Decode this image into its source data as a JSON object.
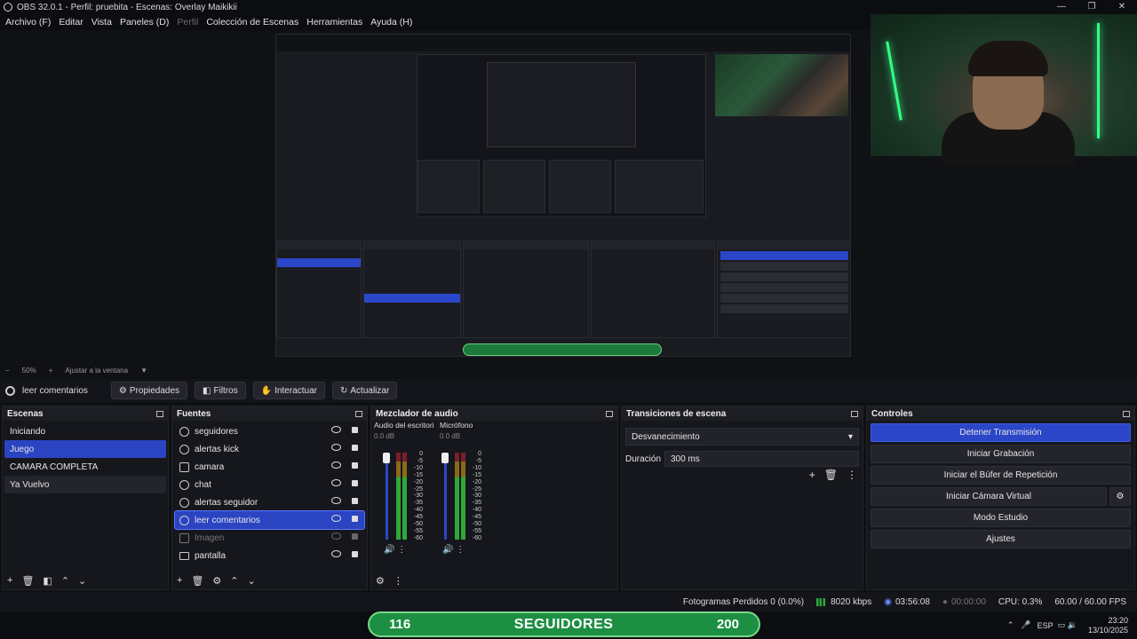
{
  "titlebar": {
    "text": "OBS 32.0.1 - Perfil: pruebita - Escenas: Overlay Maikikii"
  },
  "menu": [
    "Archivo (F)",
    "Editar",
    "Vista",
    "Paneles (D)",
    "Perfil",
    "Colección de Escenas",
    "Herramientas",
    "Ayuda (H)"
  ],
  "zoom": {
    "value": "50%",
    "fit_label": "Ajustar a la ventana"
  },
  "source_toolbar": {
    "selected": "leer comentarios",
    "buttons": [
      "Propiedades",
      "Filtros",
      "Interactuar",
      "Actualizar"
    ]
  },
  "scenes": {
    "title": "Escenas",
    "items": [
      "Iniciando",
      "Juego",
      "CAMARA COMPLETA",
      "Ya Vuelvo"
    ],
    "selected": "Juego"
  },
  "sources": {
    "title": "Fuentes",
    "items": [
      {
        "name": "seguidores",
        "icon": "browser-icon"
      },
      {
        "name": "alertas kick",
        "icon": "browser-icon"
      },
      {
        "name": "camara",
        "icon": "camera-icon"
      },
      {
        "name": "chat",
        "icon": "browser-icon"
      },
      {
        "name": "alertas seguidor",
        "icon": "browser-icon"
      },
      {
        "name": "leer comentarios",
        "icon": "browser-icon",
        "selected": true
      },
      {
        "name": "Imagen",
        "icon": "image-icon",
        "hidden": true
      },
      {
        "name": "pantalla",
        "icon": "monitor-icon"
      }
    ]
  },
  "mixer": {
    "title": "Mezclador de audio",
    "channels": [
      {
        "name": "Audio del escritorio",
        "db": "0.0 dB"
      },
      {
        "name": "Micrófono",
        "db": "0.0 dB"
      }
    ],
    "scale": [
      "0",
      "-5",
      "-10",
      "-15",
      "-20",
      "-25",
      "-30",
      "-35",
      "-40",
      "-45",
      "-50",
      "-55",
      "-60"
    ]
  },
  "transitions": {
    "title": "Transiciones de escena",
    "selected": "Desvanecimiento",
    "duration_label": "Duración",
    "duration": "300 ms"
  },
  "controls": {
    "title": "Controles",
    "buttons": [
      "Detener Transmisión",
      "Iniciar Grabación",
      "Iniciar el Búfer de Repetición",
      "Iniciar Cámara Virtual",
      "Modo Estudio",
      "Ajustes"
    ]
  },
  "status": {
    "dropped": "Fotogramas Perdidos 0 (0.0%)",
    "kbps": "8020 kbps",
    "stream_time": "03:56:08",
    "rec_time": "00:00:00",
    "cpu": "CPU: 0.3%",
    "fps": "60.00 / 60.00 FPS"
  },
  "overlay": {
    "left": "116",
    "label": "SEGUIDORES",
    "right": "200"
  },
  "tray": {
    "lang": "ESP",
    "time": "23:20",
    "date": "13/10/2025"
  },
  "colors": {
    "accent": "#2b46c8",
    "meter_green": "#2fa83a",
    "follower_green": "#1d8f43"
  }
}
